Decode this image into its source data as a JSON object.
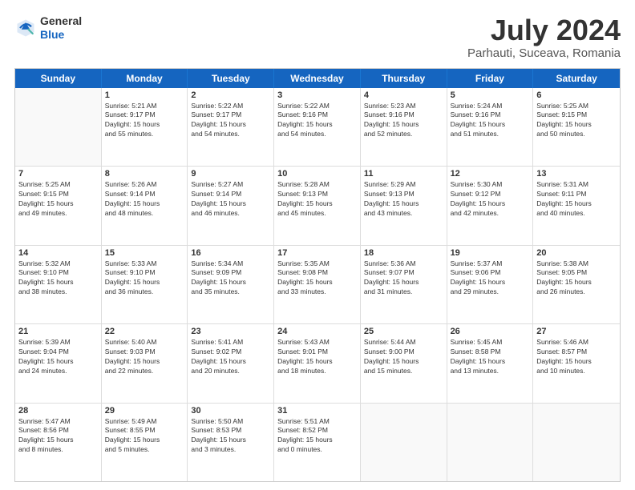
{
  "header": {
    "logo_general": "General",
    "logo_blue": "Blue",
    "title": "July 2024",
    "subtitle": "Parhauti, Suceava, Romania"
  },
  "days": [
    "Sunday",
    "Monday",
    "Tuesday",
    "Wednesday",
    "Thursday",
    "Friday",
    "Saturday"
  ],
  "weeks": [
    [
      {
        "num": "",
        "lines": []
      },
      {
        "num": "1",
        "lines": [
          "Sunrise: 5:21 AM",
          "Sunset: 9:17 PM",
          "Daylight: 15 hours",
          "and 55 minutes."
        ]
      },
      {
        "num": "2",
        "lines": [
          "Sunrise: 5:22 AM",
          "Sunset: 9:17 PM",
          "Daylight: 15 hours",
          "and 54 minutes."
        ]
      },
      {
        "num": "3",
        "lines": [
          "Sunrise: 5:22 AM",
          "Sunset: 9:16 PM",
          "Daylight: 15 hours",
          "and 54 minutes."
        ]
      },
      {
        "num": "4",
        "lines": [
          "Sunrise: 5:23 AM",
          "Sunset: 9:16 PM",
          "Daylight: 15 hours",
          "and 52 minutes."
        ]
      },
      {
        "num": "5",
        "lines": [
          "Sunrise: 5:24 AM",
          "Sunset: 9:16 PM",
          "Daylight: 15 hours",
          "and 51 minutes."
        ]
      },
      {
        "num": "6",
        "lines": [
          "Sunrise: 5:25 AM",
          "Sunset: 9:15 PM",
          "Daylight: 15 hours",
          "and 50 minutes."
        ]
      }
    ],
    [
      {
        "num": "7",
        "lines": [
          "Sunrise: 5:25 AM",
          "Sunset: 9:15 PM",
          "Daylight: 15 hours",
          "and 49 minutes."
        ]
      },
      {
        "num": "8",
        "lines": [
          "Sunrise: 5:26 AM",
          "Sunset: 9:14 PM",
          "Daylight: 15 hours",
          "and 48 minutes."
        ]
      },
      {
        "num": "9",
        "lines": [
          "Sunrise: 5:27 AM",
          "Sunset: 9:14 PM",
          "Daylight: 15 hours",
          "and 46 minutes."
        ]
      },
      {
        "num": "10",
        "lines": [
          "Sunrise: 5:28 AM",
          "Sunset: 9:13 PM",
          "Daylight: 15 hours",
          "and 45 minutes."
        ]
      },
      {
        "num": "11",
        "lines": [
          "Sunrise: 5:29 AM",
          "Sunset: 9:13 PM",
          "Daylight: 15 hours",
          "and 43 minutes."
        ]
      },
      {
        "num": "12",
        "lines": [
          "Sunrise: 5:30 AM",
          "Sunset: 9:12 PM",
          "Daylight: 15 hours",
          "and 42 minutes."
        ]
      },
      {
        "num": "13",
        "lines": [
          "Sunrise: 5:31 AM",
          "Sunset: 9:11 PM",
          "Daylight: 15 hours",
          "and 40 minutes."
        ]
      }
    ],
    [
      {
        "num": "14",
        "lines": [
          "Sunrise: 5:32 AM",
          "Sunset: 9:10 PM",
          "Daylight: 15 hours",
          "and 38 minutes."
        ]
      },
      {
        "num": "15",
        "lines": [
          "Sunrise: 5:33 AM",
          "Sunset: 9:10 PM",
          "Daylight: 15 hours",
          "and 36 minutes."
        ]
      },
      {
        "num": "16",
        "lines": [
          "Sunrise: 5:34 AM",
          "Sunset: 9:09 PM",
          "Daylight: 15 hours",
          "and 35 minutes."
        ]
      },
      {
        "num": "17",
        "lines": [
          "Sunrise: 5:35 AM",
          "Sunset: 9:08 PM",
          "Daylight: 15 hours",
          "and 33 minutes."
        ]
      },
      {
        "num": "18",
        "lines": [
          "Sunrise: 5:36 AM",
          "Sunset: 9:07 PM",
          "Daylight: 15 hours",
          "and 31 minutes."
        ]
      },
      {
        "num": "19",
        "lines": [
          "Sunrise: 5:37 AM",
          "Sunset: 9:06 PM",
          "Daylight: 15 hours",
          "and 29 minutes."
        ]
      },
      {
        "num": "20",
        "lines": [
          "Sunrise: 5:38 AM",
          "Sunset: 9:05 PM",
          "Daylight: 15 hours",
          "and 26 minutes."
        ]
      }
    ],
    [
      {
        "num": "21",
        "lines": [
          "Sunrise: 5:39 AM",
          "Sunset: 9:04 PM",
          "Daylight: 15 hours",
          "and 24 minutes."
        ]
      },
      {
        "num": "22",
        "lines": [
          "Sunrise: 5:40 AM",
          "Sunset: 9:03 PM",
          "Daylight: 15 hours",
          "and 22 minutes."
        ]
      },
      {
        "num": "23",
        "lines": [
          "Sunrise: 5:41 AM",
          "Sunset: 9:02 PM",
          "Daylight: 15 hours",
          "and 20 minutes."
        ]
      },
      {
        "num": "24",
        "lines": [
          "Sunrise: 5:43 AM",
          "Sunset: 9:01 PM",
          "Daylight: 15 hours",
          "and 18 minutes."
        ]
      },
      {
        "num": "25",
        "lines": [
          "Sunrise: 5:44 AM",
          "Sunset: 9:00 PM",
          "Daylight: 15 hours",
          "and 15 minutes."
        ]
      },
      {
        "num": "26",
        "lines": [
          "Sunrise: 5:45 AM",
          "Sunset: 8:58 PM",
          "Daylight: 15 hours",
          "and 13 minutes."
        ]
      },
      {
        "num": "27",
        "lines": [
          "Sunrise: 5:46 AM",
          "Sunset: 8:57 PM",
          "Daylight: 15 hours",
          "and 10 minutes."
        ]
      }
    ],
    [
      {
        "num": "28",
        "lines": [
          "Sunrise: 5:47 AM",
          "Sunset: 8:56 PM",
          "Daylight: 15 hours",
          "and 8 minutes."
        ]
      },
      {
        "num": "29",
        "lines": [
          "Sunrise: 5:49 AM",
          "Sunset: 8:55 PM",
          "Daylight: 15 hours",
          "and 5 minutes."
        ]
      },
      {
        "num": "30",
        "lines": [
          "Sunrise: 5:50 AM",
          "Sunset: 8:53 PM",
          "Daylight: 15 hours",
          "and 3 minutes."
        ]
      },
      {
        "num": "31",
        "lines": [
          "Sunrise: 5:51 AM",
          "Sunset: 8:52 PM",
          "Daylight: 15 hours",
          "and 0 minutes."
        ]
      },
      {
        "num": "",
        "lines": []
      },
      {
        "num": "",
        "lines": []
      },
      {
        "num": "",
        "lines": []
      }
    ]
  ]
}
